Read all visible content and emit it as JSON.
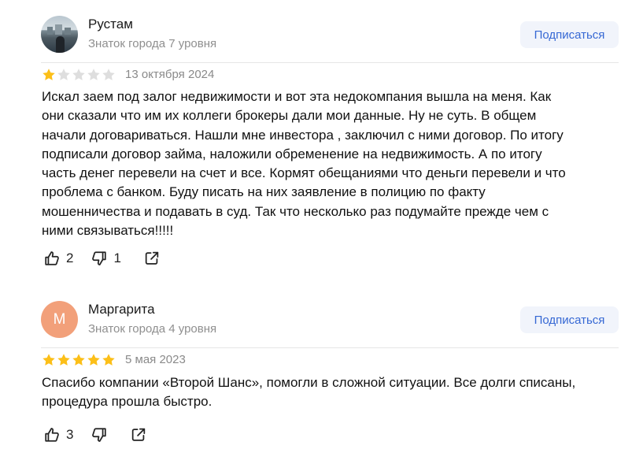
{
  "reviews": [
    {
      "author": "Рустам",
      "level": "Знаток города 7 уровня",
      "avatar_icon": "user-photo",
      "subscribe_label": "Подписаться",
      "rating": 1,
      "rating_max": 5,
      "date": "13 октября 2024",
      "text_lines": [
        "Искал заем под залог недвижимости и вот эта недокомпания вышла на меня. Как",
        "они сказали что им их коллеги брокеры дали мои данные. Ну не суть. В общем",
        "начали договариваться. Нашли мне инвестора , заключил с ними договор. По итогу",
        "подписали договор займа, наложили обременение на недвижимость. А по итогу",
        "часть денег перевели на счет и все. Кормят обещаниями что деньги перевели и что",
        "проблема с банком. Буду писать на них заявление в полицию по факту",
        "мошенничества и подавать в суд. Так что несколько раз подумайте прежде чем с",
        "ними связываться!!!!!"
      ],
      "likes": "2",
      "dislikes": "1"
    },
    {
      "author": "Маргарита",
      "level": "Знаток города 4 уровня",
      "avatar_letter": "М",
      "avatar_color": "#f2a07a",
      "subscribe_label": "Подписаться",
      "rating": 5,
      "rating_max": 5,
      "date": "5 мая 2023",
      "text_lines": [
        "Спасибо компании «Второй Шанс», помогли в сложной ситуации. Все долги списаны,",
        "процедура прошла быстро."
      ],
      "likes": "3",
      "dislikes": ""
    }
  ],
  "colors": {
    "star_filled": "#fcbf18",
    "star_empty": "#dedede",
    "subscribe_bg": "#f1f4fb",
    "subscribe_text": "#3668d4",
    "muted_text": "#8f8f8f"
  },
  "icons": [
    "thumbs-up-icon",
    "thumbs-down-icon",
    "share-icon",
    "star-icon"
  ]
}
